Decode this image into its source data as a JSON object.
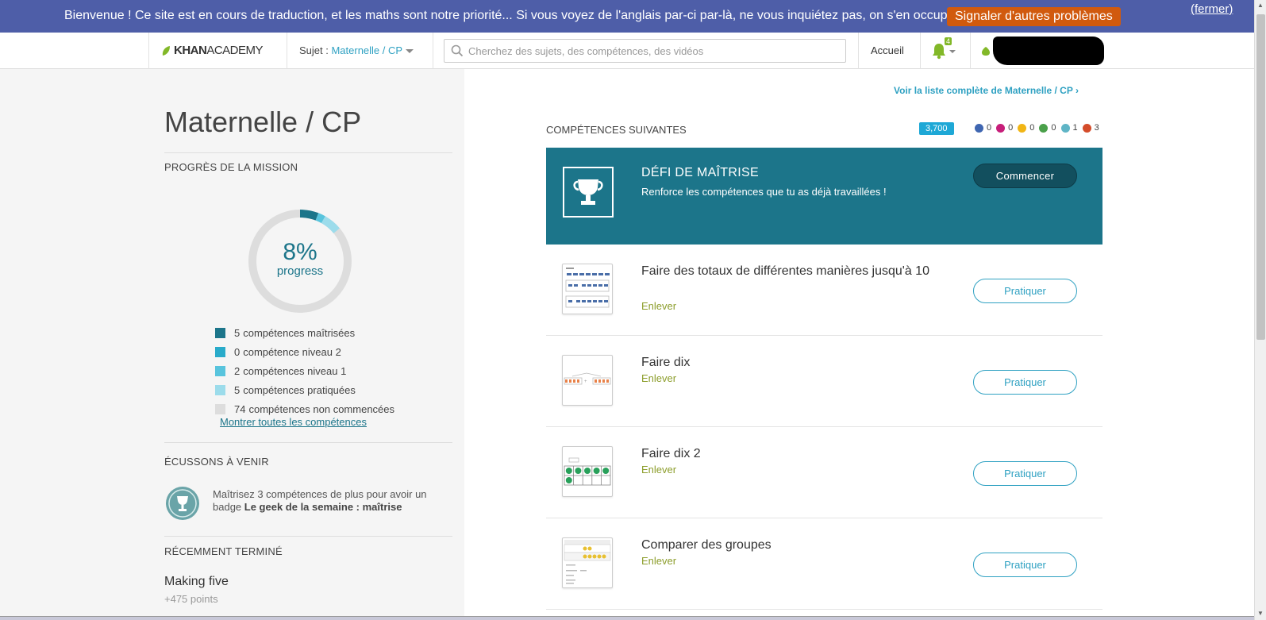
{
  "banner": {
    "message": "Bienvenue ! Ce site est en cours de traduction, et les maths sont notre priorité... Si vous voyez de l'anglais par-ci par-là, ne vous inquiétez pas, on s'en occupe !",
    "report_button": "Signaler d'autres problèmes",
    "close_link": "(fermer)"
  },
  "nav": {
    "logo_khan": "KHAN",
    "logo_academy": "ACADEMY",
    "subject_label": "Sujet : ",
    "subject_value": "Maternelle / CP",
    "search_placeholder": "Cherchez des sujets, des compétences, des vidéos",
    "home": "Accueil",
    "notification_count": "4"
  },
  "sidebar": {
    "title": "Maternelle / CP",
    "mission_heading": "PROGRÈS DE LA MISSION",
    "progress": {
      "percent_text": "8%",
      "label": "progress",
      "percent": 8
    },
    "legend": [
      {
        "count": "5",
        "label": "compétences maîtrisées",
        "color": "#1c758a"
      },
      {
        "count": "0",
        "label": "compétence niveau 2",
        "color": "#29abca"
      },
      {
        "count": "2",
        "label": "compétences niveau 1",
        "color": "#58c4dd"
      },
      {
        "count": "5",
        "label": "compétences pratiquées",
        "color": "#9cdceb"
      },
      {
        "count": "74",
        "label": "compétences non commencées",
        "color": "#dddddd"
      }
    ],
    "show_all": "Montrer toutes les compétences",
    "badges_heading": "ÉCUSSONS À VENIR",
    "badge_text_1": "Maîtrisez 3 compétences de plus pour avoir un badge ",
    "badge_text_bold": "Le geek de la semaine : maîtrise",
    "recent_heading": "RÉCEMMENT TERMINÉ",
    "recent_title": "Making five",
    "recent_points": "+475 points"
  },
  "main": {
    "full_list_link": "Voir la liste complète de Maternelle / CP",
    "next_heading": "COMPÉTENCES SUIVANTES",
    "points": "3,700",
    "stats": [
      {
        "value": "0",
        "color": "#3f66b1"
      },
      {
        "value": "0",
        "color": "#c71e7a"
      },
      {
        "value": "0",
        "color": "#f1b515"
      },
      {
        "value": "0",
        "color": "#4aa04a"
      },
      {
        "value": "1",
        "color": "#5fb5c6"
      },
      {
        "value": "3",
        "color": "#d44c2a"
      }
    ],
    "mastery": {
      "title": "DÉFI DE MAÎTRISE",
      "subtitle": "Renforce les compétences que tu as déjà travaillées !",
      "button": "Commencer"
    },
    "skills": [
      {
        "title": "Faire des totaux de différentes manières jusqu'à 10",
        "sub": "Enlever",
        "button": "Pratiquer"
      },
      {
        "title": "Faire dix",
        "sub": "Enlever",
        "button": "Pratiquer"
      },
      {
        "title": "Faire dix 2",
        "sub": "Enlever",
        "button": "Pratiquer"
      },
      {
        "title": "Comparer des groupes",
        "sub": "Enlever",
        "button": "Pratiquer"
      }
    ]
  }
}
